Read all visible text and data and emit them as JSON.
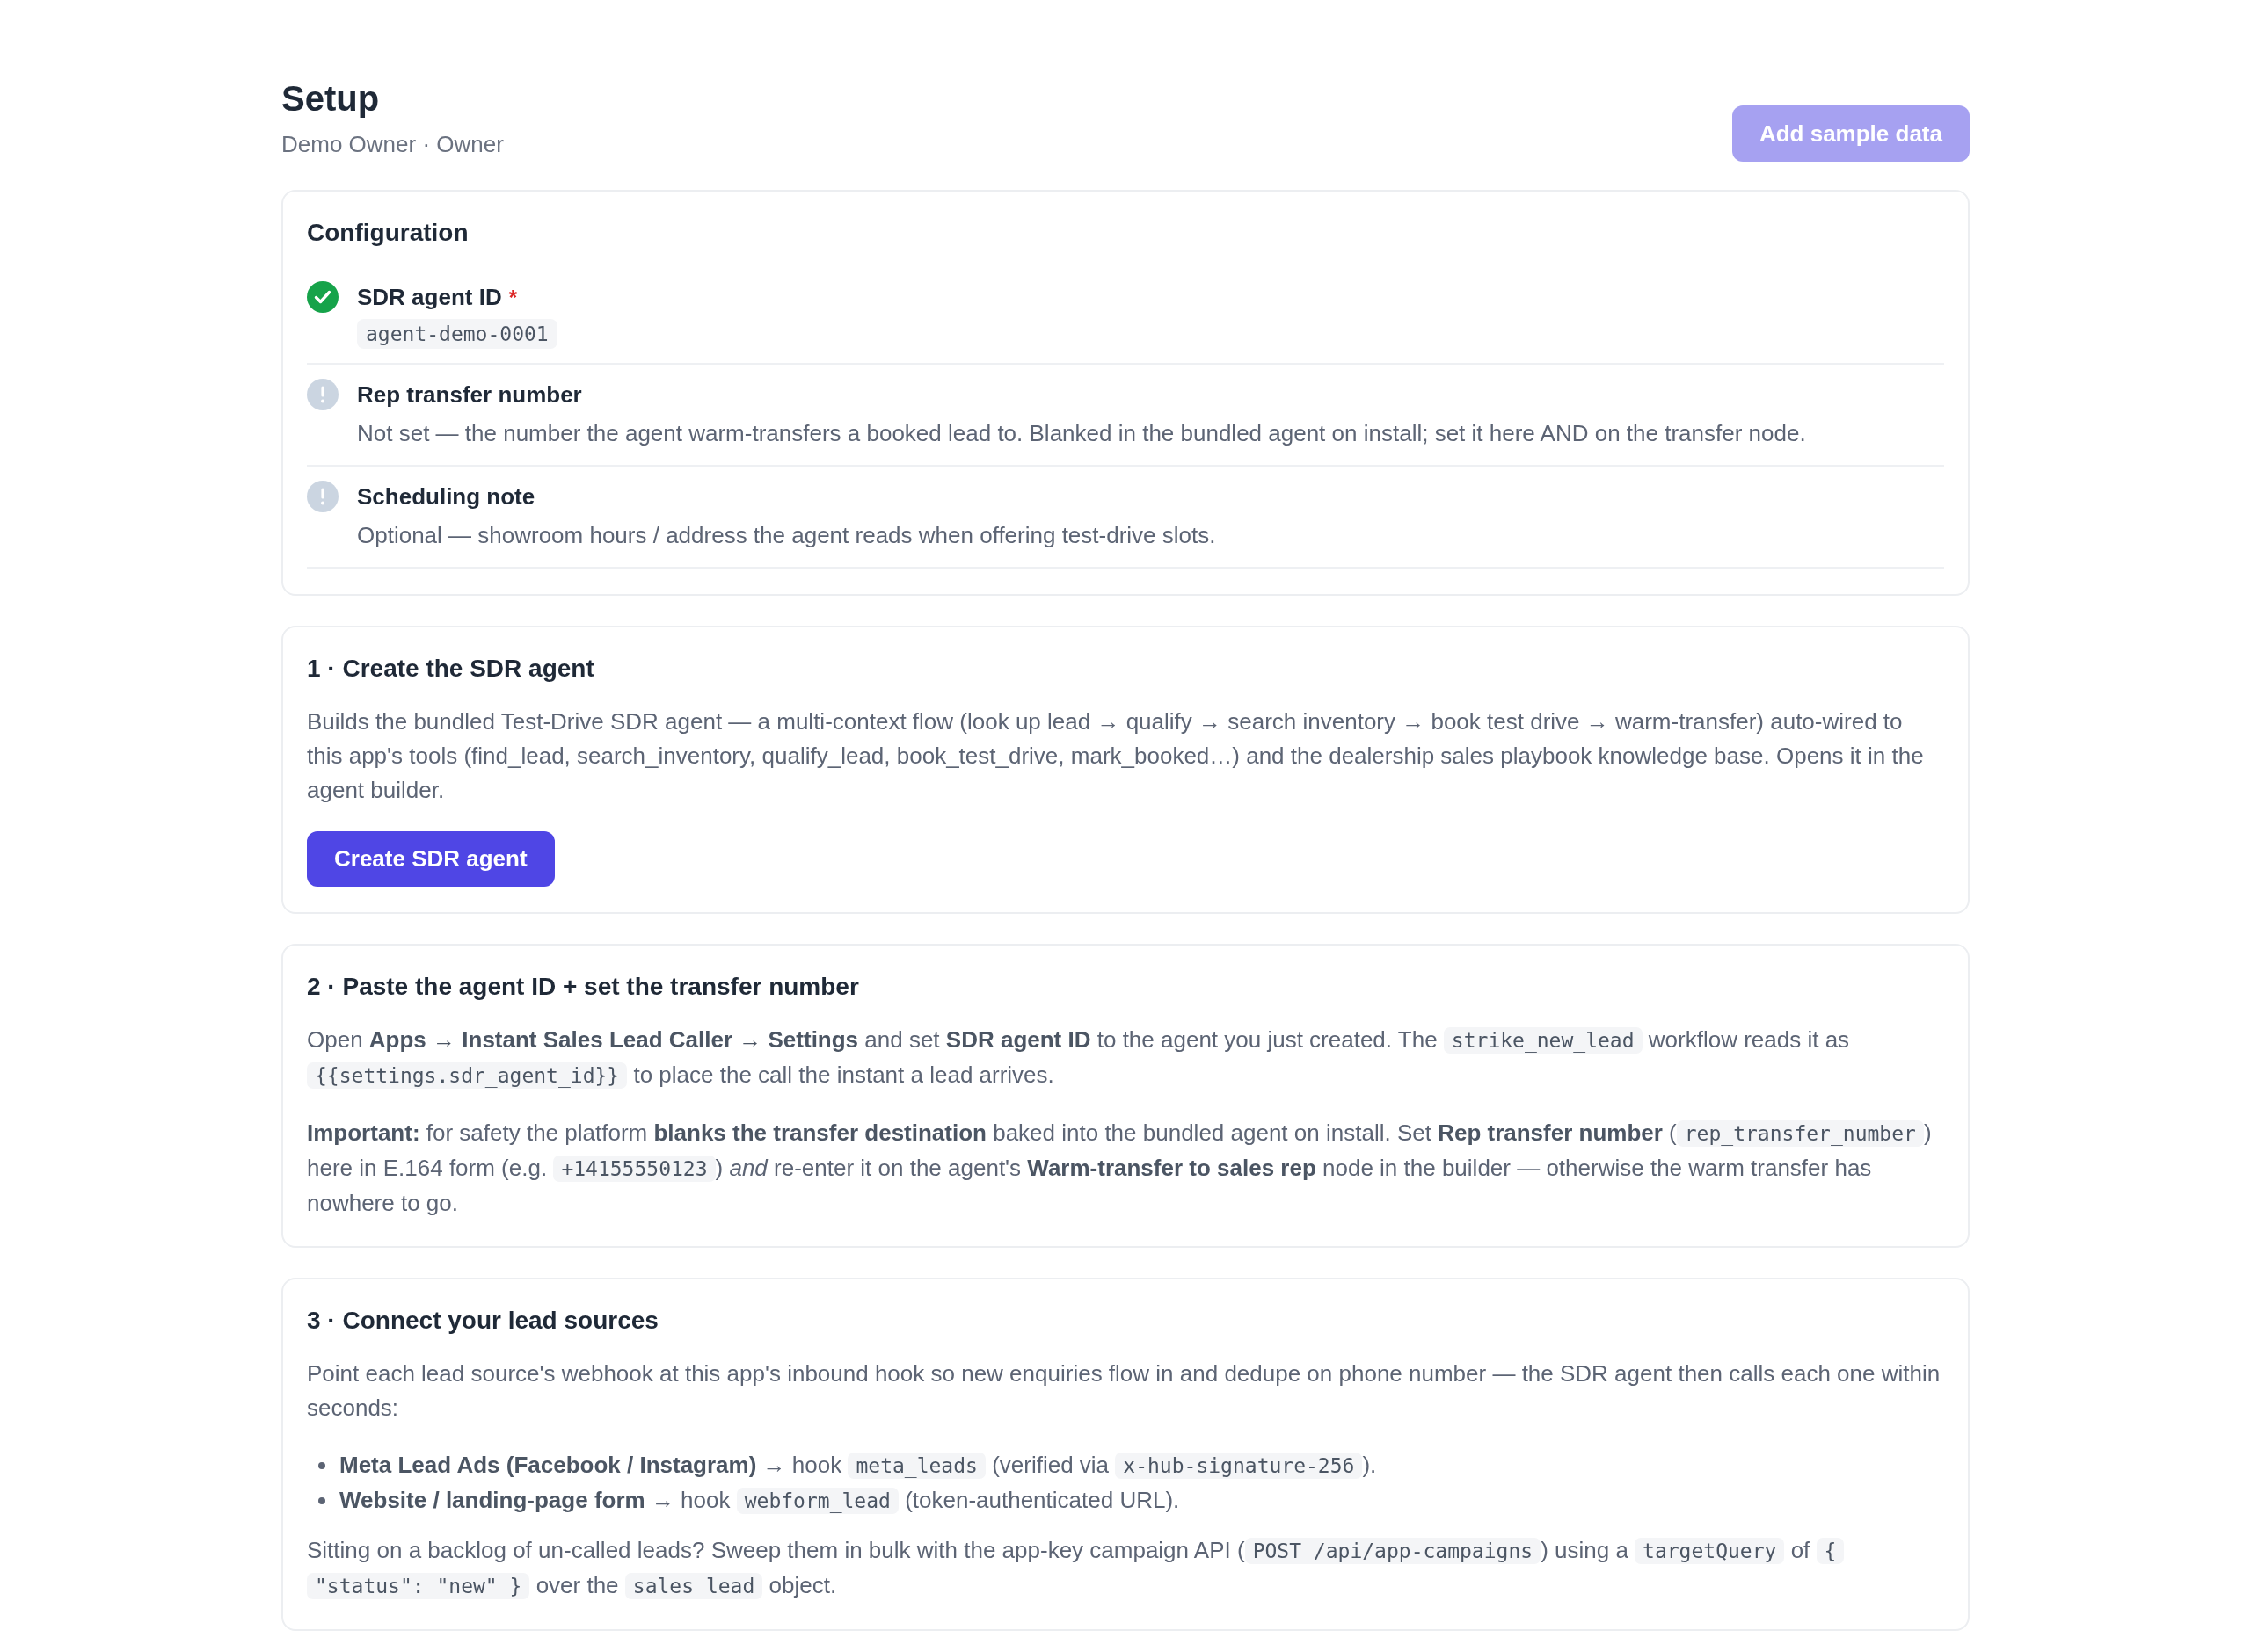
{
  "header": {
    "title": "Setup",
    "subtitle": "Demo Owner · Owner",
    "action": {
      "label": "Add sample data",
      "disabled": true
    }
  },
  "configuration": {
    "title": "Configuration",
    "items": [
      {
        "label": "SDR agent ID",
        "required_mark": "*",
        "done": true,
        "value": "agent-demo-0001"
      },
      {
        "label": "Rep transfer number",
        "done": false,
        "description": "Not set — the number the agent warm-transfers a booked lead to. Blanked in the bundled agent on install; set it here AND on the transfer node."
      },
      {
        "label": "Scheduling note",
        "done": false,
        "description": "Optional — showroom hours / address the agent reads when offering test-drive slots."
      }
    ]
  },
  "steps": [
    {
      "title": "1 · Create the SDR agent",
      "blocks": [
        {
          "kind": "paragraph",
          "segments": [
            {
              "kind": "text",
              "text": "Builds the bundled Test-Drive SDR agent — a multi-context flow (look up lead → qualify → search inventory → book test drive → warm-transfer) auto-wired to this app's tools (find_lead, search_inventory, qualify_lead, book_test_drive, mark_booked…) and the dealership sales playbook knowledge base. Opens it in the agent builder."
            }
          ]
        },
        {
          "kind": "button",
          "label": "Create SDR agent",
          "disabled": false
        }
      ]
    },
    {
      "title": "2 · Paste the agent ID + set the transfer number",
      "blocks": [
        {
          "kind": "paragraph",
          "segments": [
            {
              "kind": "text",
              "text": "Open **Apps → Instant Sales Lead Caller → Settings** and set **SDR agent ID** to the agent you just created. The "
            },
            {
              "kind": "code",
              "text": "strike_new_lead"
            },
            {
              "kind": "text",
              "text": " workflow reads it as "
            },
            {
              "kind": "code",
              "text": "{{settings.sdr_agent_id}}"
            },
            {
              "kind": "text",
              "text": " to place the call the instant a lead arrives."
            }
          ]
        },
        {
          "kind": "paragraph",
          "segments": [
            {
              "kind": "text",
              "text": "**Important:** for safety the platform **blanks the transfer destination** baked into the bundled agent on install. Set **Rep transfer number** ("
            },
            {
              "kind": "code",
              "text": "rep_transfer_number"
            },
            {
              "kind": "text",
              "text": ") here in E.164 form (e.g. "
            },
            {
              "kind": "code",
              "text": "+14155550123"
            },
            {
              "kind": "text",
              "text": ") *and* re-enter it on the agent's **Warm-transfer to sales rep** node in the builder — otherwise the warm transfer has nowhere to go."
            }
          ]
        }
      ]
    },
    {
      "title": "3 · Connect your lead sources",
      "blocks": [
        {
          "kind": "paragraph",
          "segments": [
            {
              "kind": "text",
              "text": "Point each lead source's webhook at this app's inbound hook so new enquiries flow in and dedupe on phone number — the SDR agent then calls each one within seconds:"
            }
          ]
        },
        {
          "kind": "list",
          "items": [
            {
              "segments": [
                {
                  "kind": "text",
                  "text": "**Meta Lead Ads (Facebook / Instagram)** → hook "
                },
                {
                  "kind": "code",
                  "text": "meta_leads"
                },
                {
                  "kind": "text",
                  "text": " (verified via "
                },
                {
                  "kind": "code",
                  "text": "x-hub-signature-256"
                },
                {
                  "kind": "text",
                  "text": ")."
                }
              ]
            },
            {
              "segments": [
                {
                  "kind": "text",
                  "text": "**Website / landing-page form** → hook "
                },
                {
                  "kind": "code",
                  "text": "webform_lead"
                },
                {
                  "kind": "text",
                  "text": " (token-authenticated URL)."
                }
              ]
            }
          ]
        },
        {
          "kind": "paragraph",
          "segments": [
            {
              "kind": "text",
              "text": "Sitting on a backlog of un-called leads? Sweep them in bulk with the app-key campaign API ("
            },
            {
              "kind": "code",
              "text": "POST /api/app-campaigns"
            },
            {
              "kind": "text",
              "text": ") using a "
            },
            {
              "kind": "code",
              "text": "targetQuery"
            },
            {
              "kind": "text",
              "text": " of "
            },
            {
              "kind": "code",
              "text": "{ \"status\": \"new\" }"
            },
            {
              "kind": "text",
              "text": " over the "
            },
            {
              "kind": "code",
              "text": "sales_lead"
            },
            {
              "kind": "text",
              "text": " object."
            }
          ]
        }
      ]
    }
  ]
}
